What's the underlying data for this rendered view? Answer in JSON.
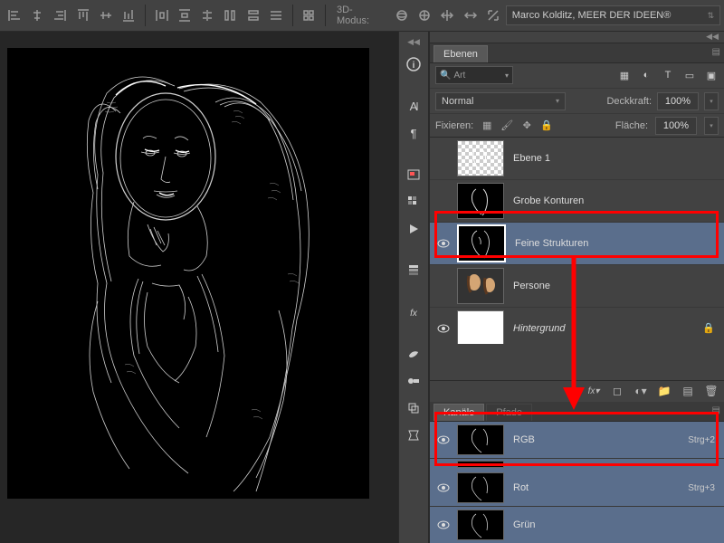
{
  "topbar": {
    "mode3d_label": "3D-Modus:",
    "profile": "Marco Kolditz, MEER DER IDEEN®"
  },
  "layers_panel": {
    "tab": "Ebenen",
    "search_placeholder": "Art",
    "blend_mode": "Normal",
    "opacity_label": "Deckkraft:",
    "opacity_value": "100%",
    "lock_label": "Fixieren:",
    "fill_label": "Fläche:",
    "fill_value": "100%",
    "layers": [
      {
        "name": "Ebene 1",
        "italic": false,
        "visible": false,
        "locked": false
      },
      {
        "name": "Grobe Konturen",
        "italic": false,
        "visible": false,
        "locked": false
      },
      {
        "name": "Feine Strukturen",
        "italic": false,
        "visible": true,
        "locked": false,
        "selected": true
      },
      {
        "name": "Persone",
        "italic": false,
        "visible": false,
        "locked": false
      },
      {
        "name": "Hintergrund",
        "italic": true,
        "visible": true,
        "locked": true
      }
    ]
  },
  "channels_panel": {
    "tab_active": "Kanäle",
    "tab_inactive": "Pfade",
    "channels": [
      {
        "name": "RGB",
        "shortcut": "Strg+2",
        "selected": true
      },
      {
        "name": "Rot",
        "shortcut": "Strg+3"
      },
      {
        "name": "Grün",
        "shortcut": ""
      }
    ]
  }
}
